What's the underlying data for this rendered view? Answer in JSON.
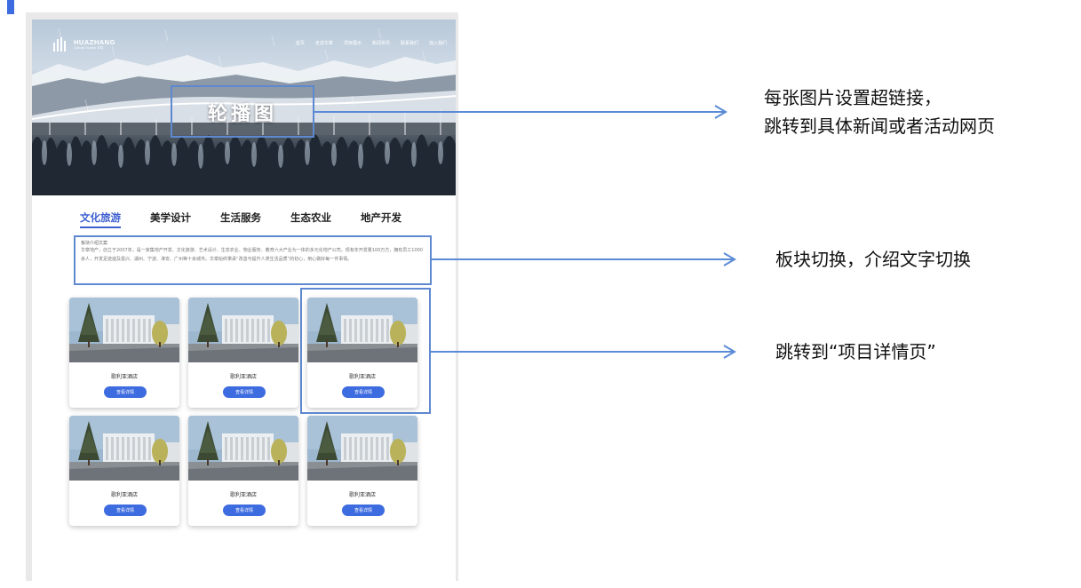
{
  "header": {
    "brand_name": "HUAZHANG",
    "brand_sub": "Cultural Tourism 华章",
    "nav": [
      "首页",
      "走进华章",
      "项目展示",
      "新闻资讯",
      "联系我们",
      "加入我们"
    ]
  },
  "hero": {
    "caption": "轮播图"
  },
  "tabs": [
    {
      "label": "文化旅游",
      "active": true
    },
    {
      "label": "美学设计",
      "active": false
    },
    {
      "label": "生活服务",
      "active": false
    },
    {
      "label": "生态农业",
      "active": false
    },
    {
      "label": "地产开发",
      "active": false
    }
  ],
  "intro": {
    "title": "板块介绍文案",
    "body": "华章地产，创立于2007年，是一家集地产开发、文化旅游、艺术设计、生态农业、物业服务、教育六大产业为一体的多元化地产公司。现有年开发量100万方，拥有员工1000余人，开发足迹遍及嘉兴、湖州、宁波、淮安、广州等十余城市。华章始终秉承“改善与提升人类生活品质”的初心，用心做好每一件事情。"
  },
  "cards": [
    {
      "name": "歌利亚酒店",
      "button": "查看详情"
    },
    {
      "name": "歌利亚酒店",
      "button": "查看详情"
    },
    {
      "name": "歌利亚酒店",
      "button": "查看详情"
    },
    {
      "name": "歌利亚酒店",
      "button": "查看详情"
    },
    {
      "name": "歌利亚酒店",
      "button": "查看详情"
    },
    {
      "name": "歌利亚酒店",
      "button": "查看详情"
    }
  ],
  "annotations": {
    "carousel_line1": "每张图片设置超链接，",
    "carousel_line2": "跳转到具体新闻或者活动网页",
    "tabs_note": "板块切换，介绍文字切换",
    "card_note": "跳转到“项目详情页”"
  },
  "colors": {
    "accent": "#3d6be0",
    "annotation_box": "#5e88cf",
    "arrow": "#5b8bd6"
  }
}
